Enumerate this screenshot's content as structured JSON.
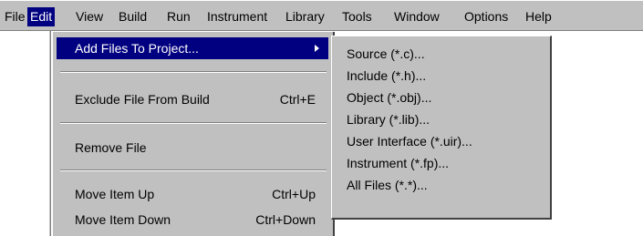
{
  "menubar": {
    "items": [
      {
        "label": "File"
      },
      {
        "label": "Edit"
      },
      {
        "label": "View"
      },
      {
        "label": "Build"
      },
      {
        "label": "Run"
      },
      {
        "label": "Instrument"
      },
      {
        "label": "Library"
      },
      {
        "label": "Tools"
      },
      {
        "label": "Window"
      },
      {
        "label": "Options"
      },
      {
        "label": "Help"
      }
    ],
    "active": "Edit"
  },
  "edit_menu": {
    "add_files": {
      "label": "Add Files To Project..."
    },
    "exclude_file": {
      "label": "Exclude File From Build",
      "shortcut": "Ctrl+E"
    },
    "remove_file": {
      "label": "Remove File"
    },
    "move_up": {
      "label": "Move Item Up",
      "shortcut": "Ctrl+Up"
    },
    "move_down": {
      "label": "Move Item Down",
      "shortcut": "Ctrl+Down"
    }
  },
  "submenu": {
    "items": [
      {
        "label": "Source (*.c)..."
      },
      {
        "label": "Include (*.h)..."
      },
      {
        "label": "Object (*.obj)..."
      },
      {
        "label": "Library (*.lib)..."
      },
      {
        "label": "User Interface (*.uir)..."
      },
      {
        "label": "Instrument (*.fp)..."
      },
      {
        "label": "All Files (*.*)..."
      }
    ]
  },
  "colors": {
    "menu_bg": "#c0c0c0",
    "highlight": "#000080",
    "highlight_text": "#ffffff"
  }
}
